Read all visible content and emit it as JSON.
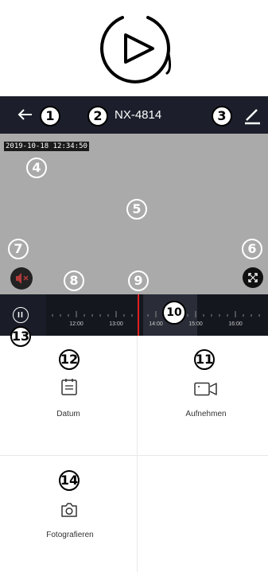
{
  "header": {
    "title": "NX-4814"
  },
  "video": {
    "timestamp": "2019-10-18 12:34:50"
  },
  "timeline": {
    "ticks": [
      "12:00",
      "13:00",
      "14:00",
      "15:00",
      "16:00"
    ]
  },
  "actions": {
    "date_label": "Datum",
    "record_label": "Aufnehmen",
    "photo_label": "Fotografieren"
  },
  "callouts": [
    "1",
    "2",
    "3",
    "4",
    "5",
    "6",
    "7",
    "8",
    "9",
    "10",
    "11",
    "12",
    "13",
    "14"
  ],
  "icons": {
    "play": "play-circle-icon",
    "back": "back-arrow-icon",
    "edit": "edit-pencil-icon",
    "mute": "speaker-muted-icon",
    "fullscreen": "fullscreen-icon",
    "pause": "pause-icon",
    "date": "calendar-icon",
    "record": "video-camera-icon",
    "photo": "camera-icon"
  },
  "colors": {
    "header_bg": "#1c1f2b",
    "video_bg": "#aaaaaa",
    "playhead": "#e02020"
  }
}
